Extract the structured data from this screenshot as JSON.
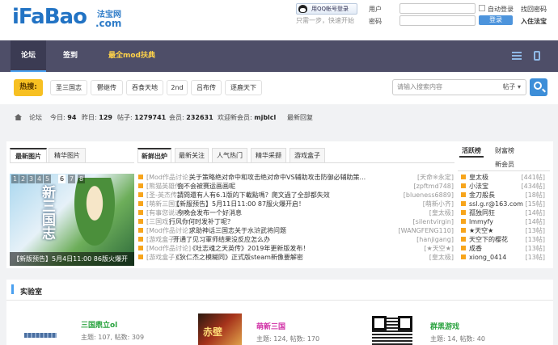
{
  "logo": {
    "main": "FaBao",
    "i": "i",
    "cn": "法宝网",
    "com": ".com"
  },
  "header": {
    "qq_login": "用QQ帐号登录",
    "qq_sub": "只需一步，快速开始",
    "user_label": "用户",
    "pass_label": "密码",
    "auto_login": "自动登录",
    "forgot": "找回密码",
    "login_btn": "登录",
    "register": "入住法宝"
  },
  "nav": {
    "items": [
      "论坛",
      "签到",
      "最全mod扶典"
    ]
  },
  "hot": {
    "label": "热搜:",
    "tags": [
      "圣三国志",
      "鬱继传",
      "吞食天地",
      "2nd",
      "吕布传",
      "逐鹿天下"
    ],
    "search_placeholder": "请输入搜索内容",
    "search_option": "帖子"
  },
  "stats": {
    "forum": "论坛",
    "today_label": "今日:",
    "today": "94",
    "yesterday_label": "昨日:",
    "yesterday": "129",
    "posts_label": "帖子:",
    "posts": "1279741",
    "members_label": "会员:",
    "members": "232631",
    "welcome": "欢迎新会员:",
    "newuser": "mjblcl",
    "latest": "最新回复"
  },
  "left_tabs": [
    "最新图片",
    "精华图片"
  ],
  "mid_tabs": [
    "新鲜出炉",
    "最新关注",
    "人气热门",
    "精华采撷",
    "游戏盒子"
  ],
  "side_tabs": [
    "活跃榜",
    "财富榜",
    "新会员"
  ],
  "slide": {
    "numbers": [
      "1",
      "2",
      "3",
      "4",
      "5",
      "6",
      "7",
      "8"
    ],
    "active": "6",
    "caption": "【新版预告】5月4日11:00 86版火爆开",
    "calli": "新三国志"
  },
  "threads": [
    {
      "cat": "[Mod作品讨论]",
      "title": "关于策略绝对命中和攻击绝对命中VS辅助攻击防御必辅助策...",
      "user": "[天命※永定]"
    },
    {
      "cat": "[熊猫英雄传]",
      "title": "会不会被赛运画画呢",
      "user": "[zpftmd748]"
    },
    {
      "cat": "[圣-英杰传]",
      "title": "請問還有人有6.1版的下載點嗎？爬文過了全部都失效",
      "user": "[blueness6889]"
    },
    {
      "cat": "[萌新三国]",
      "title": "【新服预告】5月11日11:00 87服火爆开启！",
      "user": "[萌新小齐]"
    },
    {
      "cat": "[有事您说话]",
      "title": "今晚会发布一个好消息",
      "user": "[皇太极]"
    },
    {
      "cat": "[三国戏]",
      "title": "行风你何时发补丁呢？",
      "user": "[silentvirgin]"
    },
    {
      "cat": "[Mod作品讨论]",
      "title": "求助神话三国志关于水浒武将问题",
      "user": "[WANGFENG110]"
    },
    {
      "cat": "[游戏盒子]",
      "title": "开通了见习軍师结果没反应怎么办",
      "user": "[hanjigang]"
    },
    {
      "cat": "[Mod作品讨论]",
      "title": "《吐志魂之天英传》2019年更新版发布！",
      "user": "[★天空★]"
    },
    {
      "cat": "[游戏盒子]",
      "title": "《狄仁杰之模糊同》正式版steam新像要解密",
      "user": "[皇太极]"
    }
  ],
  "ranks": [
    {
      "name": "皇太极",
      "count": "[441帖]"
    },
    {
      "name": "小法宝",
      "count": "[434帖]"
    },
    {
      "name": "金刀般長",
      "count": "[18帖]"
    },
    {
      "name": "ssl.g.r@163.com",
      "count": "[15帖]"
    },
    {
      "name": "孤独同狂",
      "count": "[14帖]"
    },
    {
      "name": "lmmyfy",
      "count": "[14帖]"
    },
    {
      "name": "★天空★",
      "count": "[13帖]"
    },
    {
      "name": "天空下的樱花",
      "count": "[13帖]"
    },
    {
      "name": "成香",
      "count": "[13帖]"
    },
    {
      "name": "xiong_0414",
      "count": "[13帖]"
    }
  ],
  "lab": {
    "title": "实验室",
    "sections": [
      {
        "name": "三国鼎立ol",
        "meta": "主题: 107, 帖数: 309",
        "color": "#2aa33f"
      },
      {
        "name": "萌新三国",
        "meta": "主题: 124, 帖数: 170",
        "color": "#d12fa6"
      },
      {
        "name": "群黑游戏",
        "meta": "主题: 14, 帖数: 40",
        "color": "#2aa33f"
      }
    ],
    "thumb2": "赤壁"
  },
  "colors": {
    "nav_bg": "#4e4e68",
    "accent": "#4aa0f0",
    "hot": "#f7c022",
    "mod": "#ffd34a"
  }
}
